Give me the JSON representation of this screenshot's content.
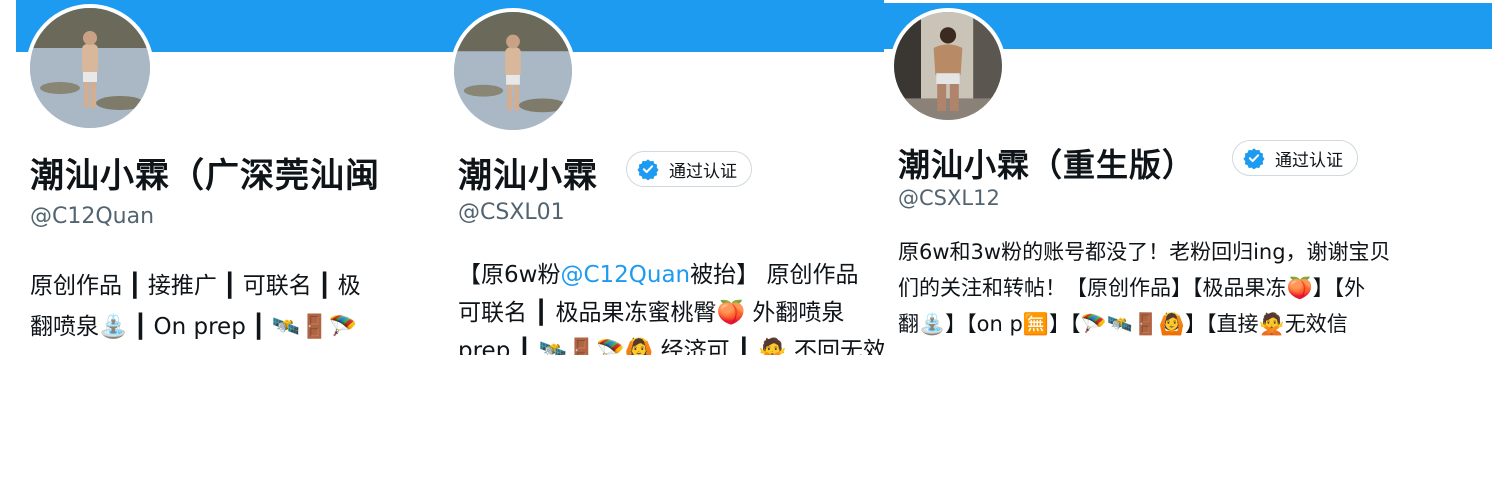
{
  "colors": {
    "banner": "#1d9bf0",
    "verified": "#1d9bf0",
    "handle": "#536471",
    "link": "#1d9bf0"
  },
  "profiles": [
    {
      "name": "潮汕小霖（广深莞汕闽",
      "handle": "@C12Quan",
      "bio": {
        "line1": [
          "原创作品",
          "接推广",
          "可联名",
          "极"
        ],
        "line2a": "翻喷泉⛲",
        "line2b": "On prep",
        "line2c": "🛰️🚪🪂"
      }
    },
    {
      "name": "潮汕小霖",
      "verified_label": "通过认证",
      "handle": "@CSXL01",
      "bio": {
        "l1_pre": "【原6w粉",
        "l1_mention": "@C12Quan",
        "l1_post": "被抬】 原创作品",
        "l2": "可联名 ┃ 极品果冻蜜桃臀🍑 外翻喷泉",
        "l3": "prep ┃ 🛰️🚪🪂🙆 经济可 ┃ 🙅 不回无效信息 ┃ 完"
      }
    },
    {
      "name": "潮汕小霖（重生版）",
      "verified_label": "通过认证",
      "handle": "@CSXL12",
      "bio": {
        "l1": "原6w和3w粉的账号都没了！老粉回归ing，谢谢宝贝",
        "l2": "们的关注和转帖！【原创作品】【极品果冻🍑】【外",
        "l3": "翻⛲】【on p🈚】【🪂🛰️🚪🙆】【直接🙅无效信"
      }
    }
  ],
  "icons": [
    "verified-check-icon",
    "avatar-photo"
  ]
}
